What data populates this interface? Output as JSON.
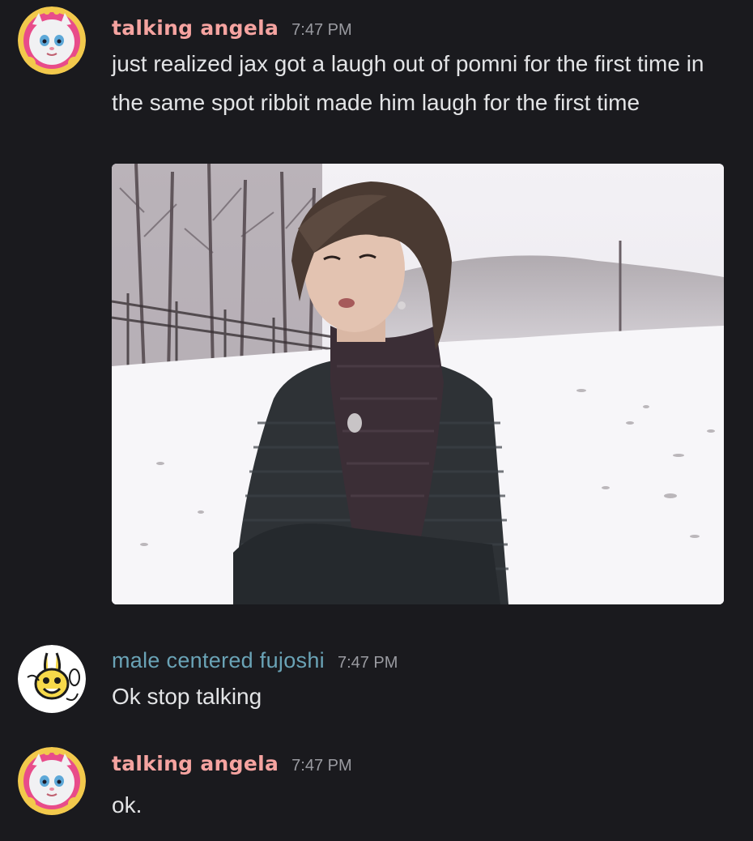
{
  "messages": [
    {
      "username": "talking angela",
      "timestamp": "7:47 PM",
      "text": "just realized jax got a laugh out of pomni for the first time in the same spot ribbit made him laugh for the first time",
      "avatar": "talking-angela-avatar",
      "attachment": "image-woman-in-snow"
    },
    {
      "username": "male centered fujoshi",
      "timestamp": "7:47 PM",
      "text": "Ok stop talking",
      "avatar": "bee-character-avatar"
    },
    {
      "username": "talking angela",
      "timestamp": "7:47 PM",
      "text": "ok.",
      "avatar": "talking-angela-avatar"
    }
  ],
  "colors": {
    "background": "#1a1a1e",
    "angela_name": "#f5a3a0",
    "fujoshi_name": "#6aa3b6",
    "timestamp": "#9a9ba1",
    "text": "#e3e4e6"
  }
}
